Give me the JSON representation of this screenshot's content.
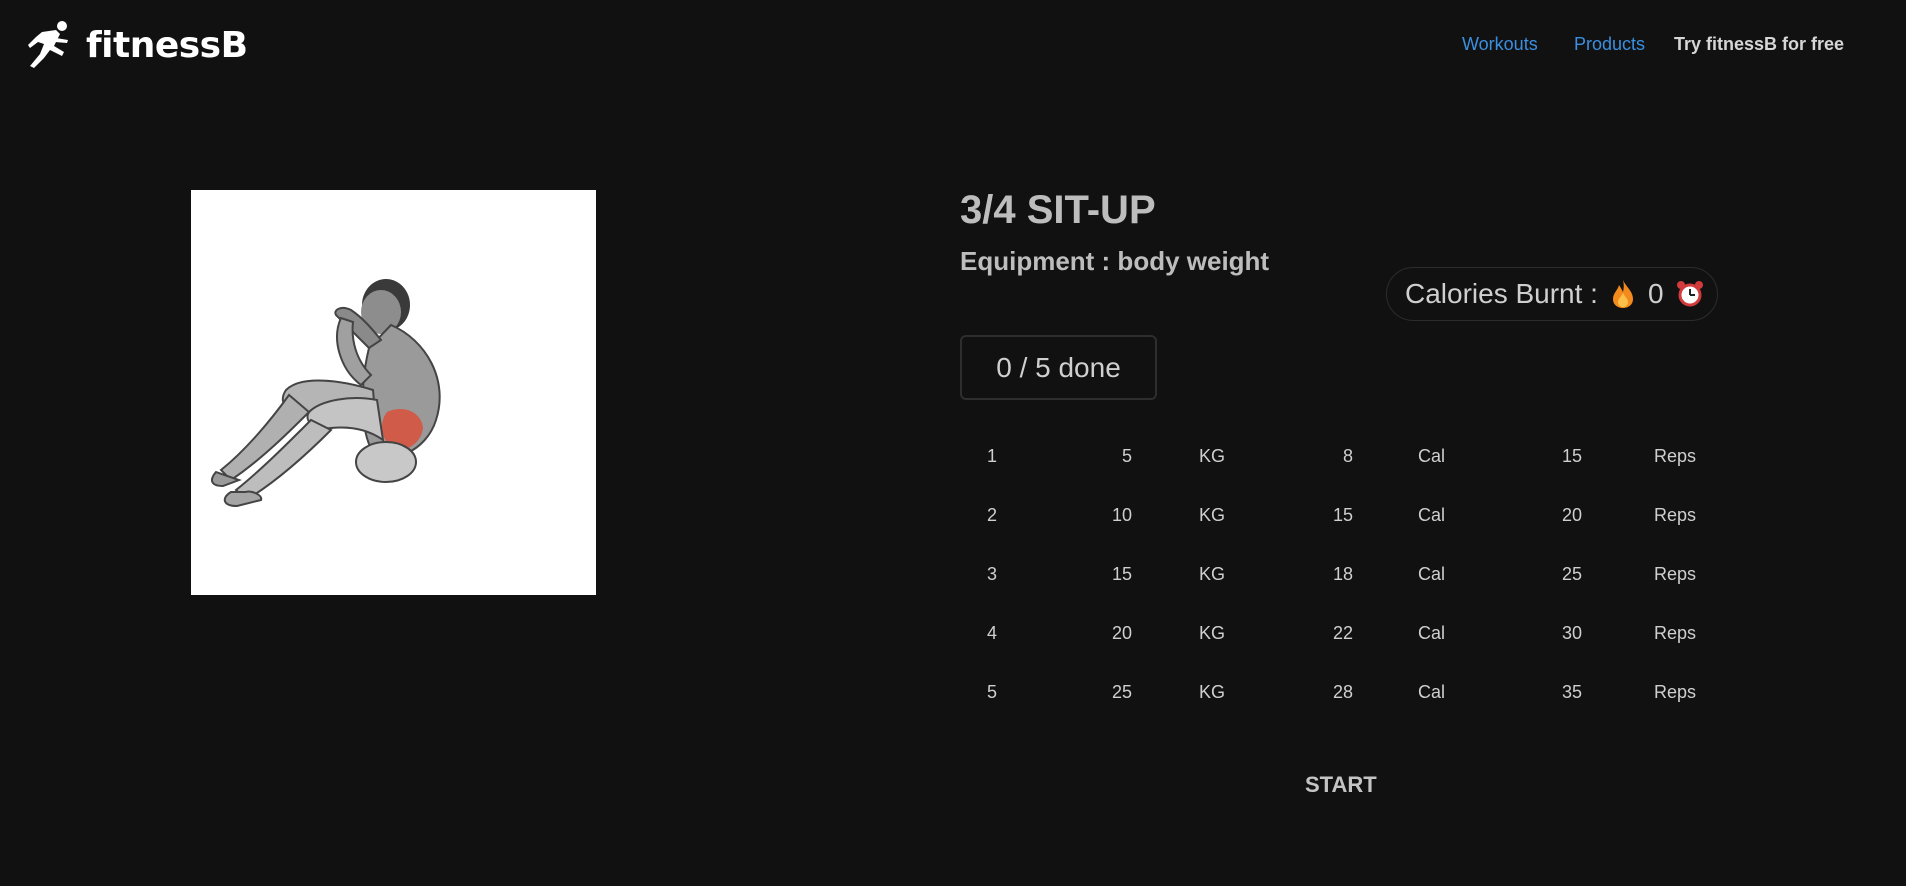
{
  "header": {
    "brand": "fitnessB",
    "nav": {
      "workouts": "Workouts",
      "products": "Products",
      "cta": "Try fitnessB for free"
    }
  },
  "exercise": {
    "title": "3/4 SIT-UP",
    "equipment_label": "Equipment : body weight",
    "image_icon": "situp-illustration"
  },
  "calories": {
    "label": "Calories Burnt :",
    "value": "0",
    "icons": [
      "flame-icon",
      "alarm-clock-icon"
    ]
  },
  "progress": {
    "text": "0 / 5 done"
  },
  "sets": [
    {
      "set": "1",
      "weight": "5",
      "weight_unit": "KG",
      "cal": "8",
      "cal_unit": "Cal",
      "reps": "15",
      "reps_unit": "Reps"
    },
    {
      "set": "2",
      "weight": "10",
      "weight_unit": "KG",
      "cal": "15",
      "cal_unit": "Cal",
      "reps": "20",
      "reps_unit": "Reps"
    },
    {
      "set": "3",
      "weight": "15",
      "weight_unit": "KG",
      "cal": "18",
      "cal_unit": "Cal",
      "reps": "25",
      "reps_unit": "Reps"
    },
    {
      "set": "4",
      "weight": "20",
      "weight_unit": "KG",
      "cal": "22",
      "cal_unit": "Cal",
      "reps": "30",
      "reps_unit": "Reps"
    },
    {
      "set": "5",
      "weight": "25",
      "weight_unit": "KG",
      "cal": "28",
      "cal_unit": "Cal",
      "reps": "35",
      "reps_unit": "Reps"
    }
  ],
  "actions": {
    "start": "START"
  },
  "colors": {
    "background": "#111111",
    "link": "#3b8fe0",
    "text": "#c8c8c8",
    "flame": "#f28a1e",
    "muscle_highlight": "#d9503a"
  }
}
